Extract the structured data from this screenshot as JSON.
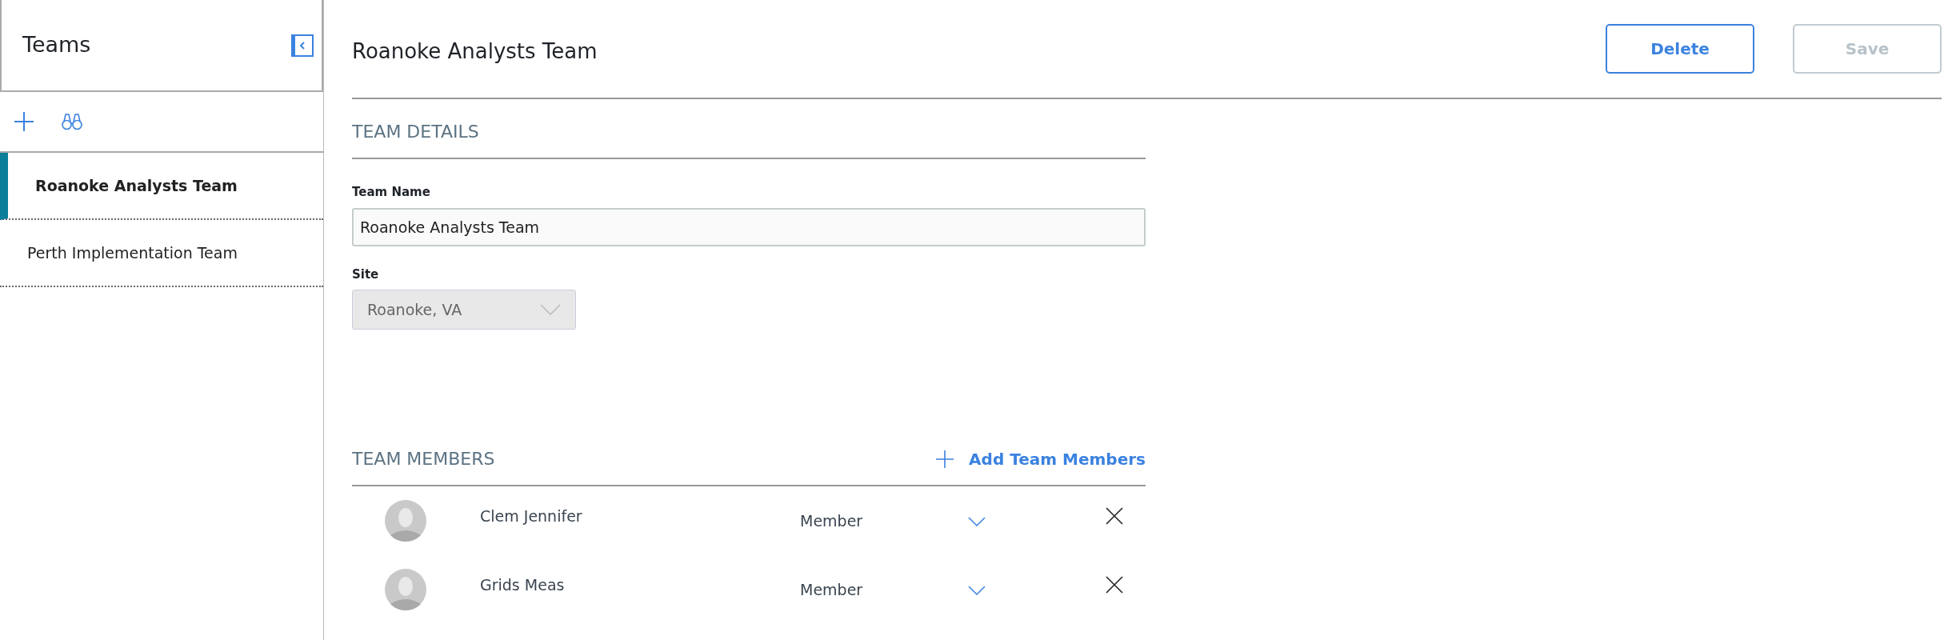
{
  "sidebar": {
    "title": "Teams",
    "items": [
      {
        "label": "Roanoke Analysts Team",
        "selected": true
      },
      {
        "label": "Perth Implementation Team",
        "selected": false
      }
    ]
  },
  "header": {
    "title": "Roanoke Analysts Team",
    "buttons": [
      {
        "label": "Delete",
        "disabled": false
      },
      {
        "label": "Save",
        "disabled": true
      }
    ]
  },
  "team_details": {
    "heading": "TEAM DETAILS",
    "fields": [
      {
        "kind": "text",
        "label": "Team Name",
        "value": "Roanoke Analysts Team",
        "disabled": false
      },
      {
        "kind": "select",
        "label": "Site",
        "value": "Roanoke, VA",
        "disabled": true
      }
    ]
  },
  "team_members": {
    "heading": "TEAM MEMBERS",
    "add_link": "Add Team Members",
    "members": [
      {
        "name": "Clem Jennifer",
        "role": "Member"
      },
      {
        "name": "Grids Meas",
        "role": "Member"
      }
    ]
  }
}
